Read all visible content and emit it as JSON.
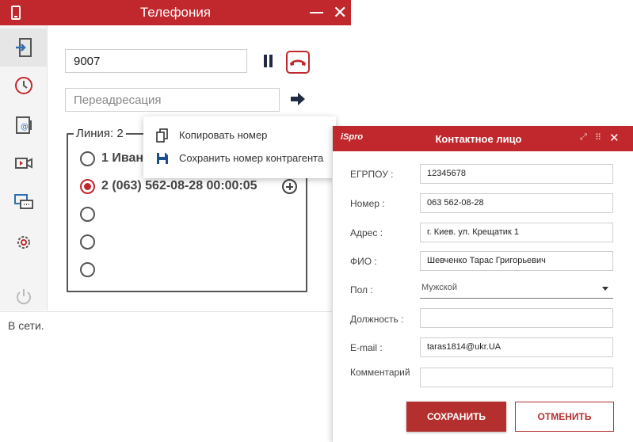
{
  "telephony": {
    "title": "Телефония",
    "number_value": "9007",
    "forward_placeholder": "Переадресация",
    "lines_legend": "Линия: 2",
    "lines": [
      {
        "text": "1 Иван",
        "selected": false
      },
      {
        "text": "2 (063) 562-08-28 00:00:05",
        "selected": true
      },
      {
        "text": "",
        "selected": false
      },
      {
        "text": "",
        "selected": false
      },
      {
        "text": "",
        "selected": false
      }
    ],
    "status": "В сети.",
    "sidebar_icons": [
      "login-icon",
      "history-clock-icon",
      "contacts-email-icon",
      "video-icon",
      "chat-icon",
      "settings-gear-icon",
      "power-icon"
    ],
    "accent_color": "#c0282d"
  },
  "context_menu": {
    "items": [
      {
        "label": "Копировать номер",
        "icon": "copy-icon"
      },
      {
        "label": "Сохранить номер контрагента",
        "icon": "save-floppy-icon"
      }
    ]
  },
  "contact_dialog": {
    "title": "Контактное лицо",
    "logo": "iSpro",
    "fields": {
      "egrpou": {
        "label": "ЕГРПОУ :",
        "value": "12345678"
      },
      "number": {
        "label": "Номер :",
        "value": "063 562-08-28"
      },
      "address": {
        "label": "Адрес :",
        "value": "г. Киев. ул. Крещатик 1"
      },
      "fio": {
        "label": "ФИО :",
        "value": "Шевченко Тарас Григорьевич"
      },
      "gender": {
        "label": "Пол :",
        "value": "Мужской"
      },
      "position": {
        "label": "Должность :",
        "value": ""
      },
      "email": {
        "label": "E-mail :",
        "value": "taras1814@ukr.UA"
      },
      "comment": {
        "label": "Комментарий",
        "value": ""
      }
    },
    "save_label": "СОХРАНИТЬ",
    "cancel_label": "ОТМЕНИТЬ"
  }
}
